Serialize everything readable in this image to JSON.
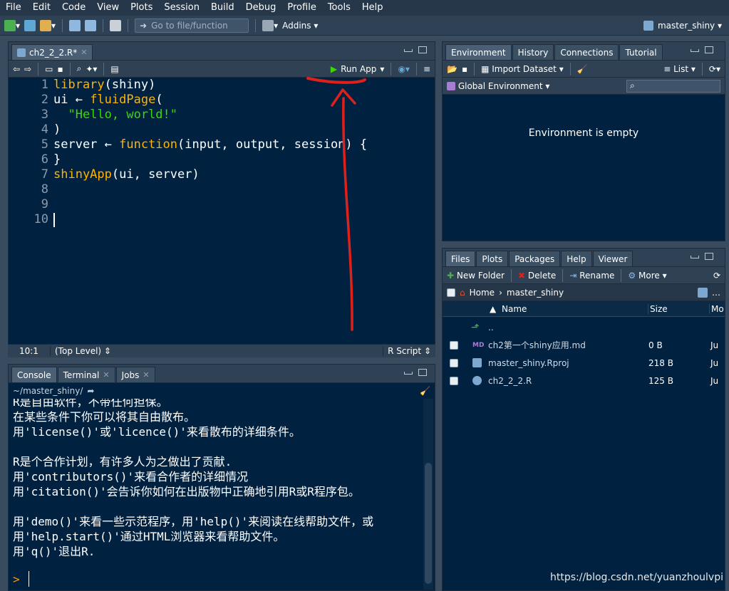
{
  "menubar": {
    "items": [
      "File",
      "Edit",
      "Code",
      "View",
      "Plots",
      "Session",
      "Build",
      "Debug",
      "Profile",
      "Tools",
      "Help"
    ],
    "project": "master_shiny"
  },
  "toolbar": {
    "goto_placeholder": "Go to file/function",
    "addins": "Addins"
  },
  "editor": {
    "tab_label": "ch2_2_2.R*",
    "run_app_label": "Run App",
    "line_numbers": [
      "1",
      "2",
      "3",
      "4",
      "5",
      "6",
      "7",
      "8",
      "9",
      "10"
    ],
    "lines": [
      "library(shiny)",
      "ui ← fluidPage(",
      "  \"Hello, world!\"",
      ")",
      "server ← function(input, output, session) {",
      "}",
      "shinyApp(ui, server)",
      "",
      "",
      ""
    ],
    "status": {
      "position": "10:1",
      "scope": "(Top Level)",
      "filetype": "R Script"
    }
  },
  "console": {
    "tabs": [
      "Console",
      "Terminal",
      "Jobs"
    ],
    "path": "~/master_shiny/",
    "lines": [
      "R是自由软件，不带任何担保。",
      "在某些条件下你可以将其自由散布。",
      "用'license()'或'licence()'来看散布的详细条件。",
      "",
      "R是个合作计划，有许多人为之做出了贡献.",
      "用'contributors()'来看合作者的详细情况",
      "用'citation()'会告诉你如何在出版物中正确地引用R或R程序包。",
      "",
      "用'demo()'来看一些示范程序，用'help()'来阅读在线帮助文件，或",
      "用'help.start()'通过HTML浏览器来看帮助文件。",
      "用'q()'退出R."
    ],
    "prompt": ">"
  },
  "env": {
    "tabs": [
      "Environment",
      "History",
      "Connections",
      "Tutorial"
    ],
    "import_label": "Import Dataset",
    "list_label": "List",
    "scope_label": "Global Environment",
    "empty_message": "Environment is empty"
  },
  "files": {
    "tabs": [
      "Files",
      "Plots",
      "Packages",
      "Help",
      "Viewer"
    ],
    "new_folder": "New Folder",
    "delete": "Delete",
    "rename": "Rename",
    "more": "More",
    "breadcrumb": {
      "home": "Home",
      "folder": "master_shiny"
    },
    "headers": {
      "name": "Name",
      "size": "Size",
      "modified": "Mo"
    },
    "parent": "..",
    "rows": [
      {
        "name": "ch2第一个shiny应用.md",
        "size": "0 B",
        "modified": "Ju"
      },
      {
        "name": "master_shiny.Rproj",
        "size": "218 B",
        "modified": "Ju"
      },
      {
        "name": "ch2_2_2.R",
        "size": "125 B",
        "modified": "Ju"
      }
    ]
  },
  "watermark": "https://blog.csdn.net/yuanzhoulvpi",
  "colors": {
    "background": "#002240",
    "keyword": "#ffb300",
    "string": "#3ad900",
    "annotation": "#e0201b"
  }
}
